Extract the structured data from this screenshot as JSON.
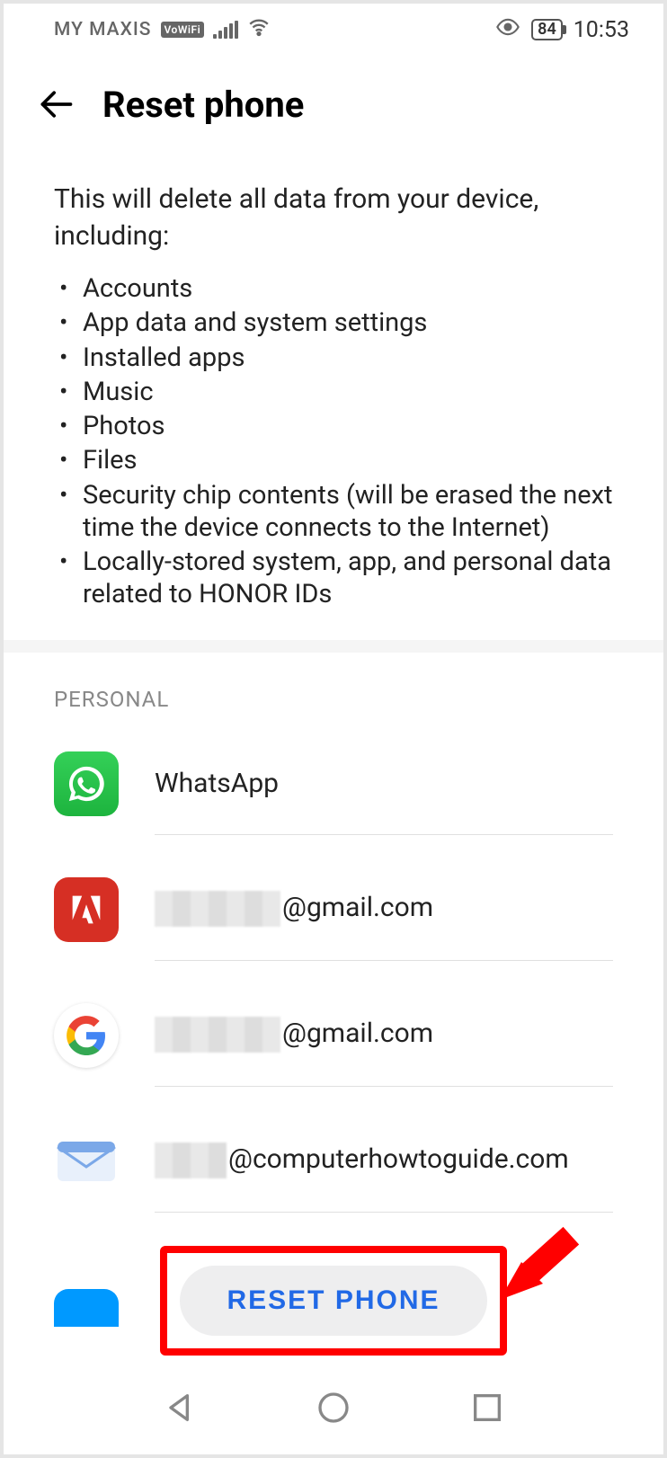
{
  "status": {
    "carrier": "MY MAXIS",
    "vowifi": "VoWiFi",
    "battery": "84",
    "time": "10:53"
  },
  "header": {
    "title": "Reset phone"
  },
  "description": {
    "intro": "This will delete all data from your device, including:",
    "items": [
      "Accounts",
      "App data and system settings",
      "Installed apps",
      "Music",
      "Photos",
      "Files",
      "Security chip contents (will be erased the next time the device connects to the Internet)",
      "Locally-stored system, app, and personal data related to HONOR IDs"
    ]
  },
  "section": {
    "personal_label": "PERSONAL"
  },
  "accounts": [
    {
      "icon": "whatsapp",
      "label": "WhatsApp",
      "redacted_prefix": false,
      "suffix": ""
    },
    {
      "icon": "adobe",
      "label": "",
      "redacted_prefix": true,
      "suffix": "@gmail.com"
    },
    {
      "icon": "google",
      "label": "",
      "redacted_prefix": true,
      "suffix": "@gmail.com"
    },
    {
      "icon": "email",
      "label": "",
      "redacted_prefix": true,
      "redacted_small": true,
      "suffix": "@computerhowtoguide.com"
    }
  ],
  "reset": {
    "button_label": "RESET PHONE"
  }
}
